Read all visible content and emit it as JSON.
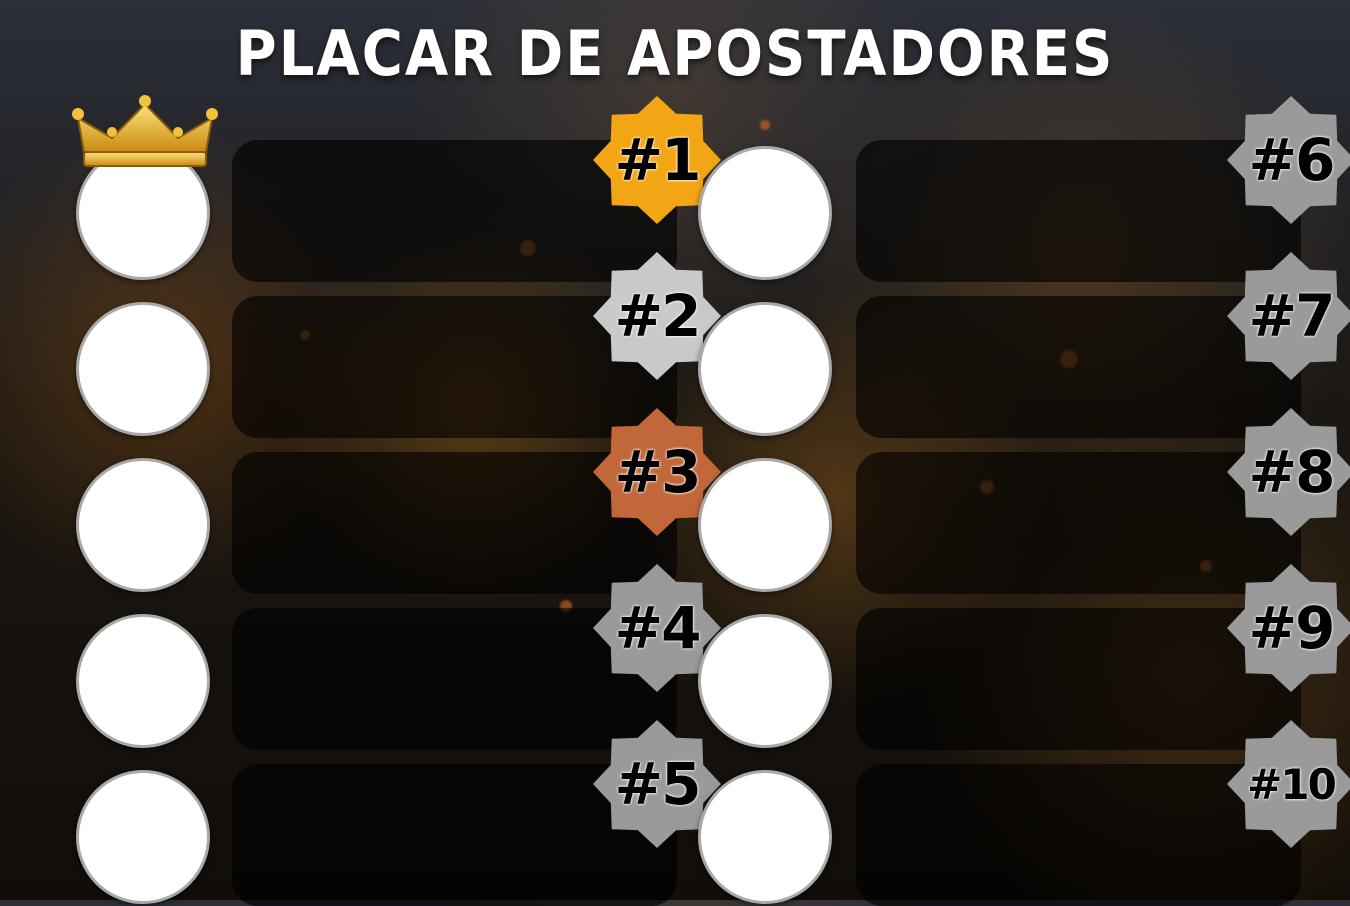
{
  "title": "PLACAR DE APOSTADORES",
  "colors": {
    "gold": "#f2a613",
    "silver": "#c9c9c9",
    "bronze": "#c1673a",
    "gray": "#9a9a9a"
  },
  "icons": [
    "crown-icon"
  ],
  "ranks": [
    {
      "label": "#1",
      "medal": "gold"
    },
    {
      "label": "#2",
      "medal": "silver"
    },
    {
      "label": "#3",
      "medal": "bronze"
    },
    {
      "label": "#4",
      "medal": "gray"
    },
    {
      "label": "#5",
      "medal": "gray"
    },
    {
      "label": "#6",
      "medal": "gray"
    },
    {
      "label": "#7",
      "medal": "gray"
    },
    {
      "label": "#8",
      "medal": "gray"
    },
    {
      "label": "#9",
      "medal": "gray"
    },
    {
      "label": "#10",
      "medal": "gray"
    }
  ]
}
